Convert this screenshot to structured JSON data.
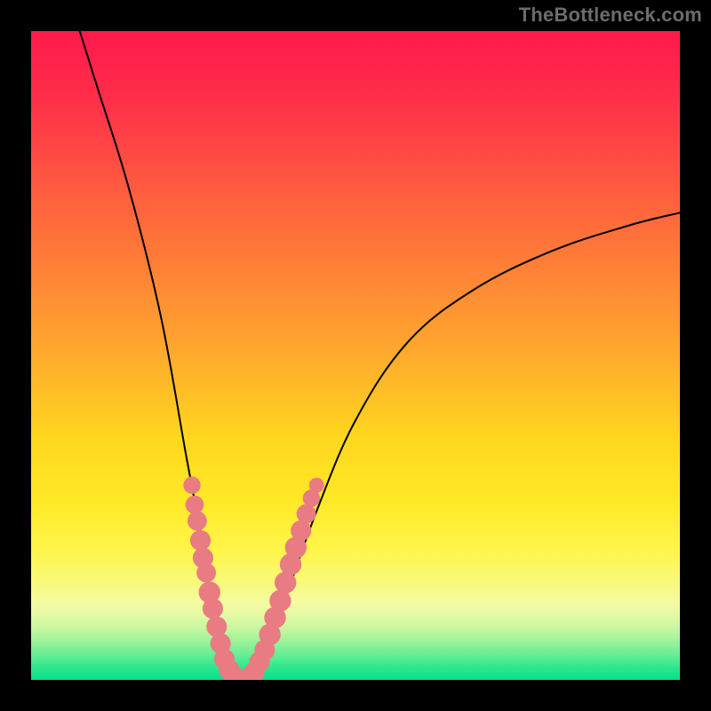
{
  "watermark": "TheBottleneck.com",
  "colors": {
    "bg": "#000000",
    "gradient_top": "#ff1a4b",
    "gradient_bottom": "#00e28b",
    "curve": "#000000",
    "marker": "#e97b82"
  },
  "chart_data": {
    "type": "line",
    "title": "",
    "xlabel": "",
    "ylabel": "",
    "xlim": [
      0,
      100
    ],
    "ylim": [
      0,
      100
    ],
    "grid": false,
    "legend": false,
    "curve_min_x": 32.5,
    "left_start_y": 108,
    "right_end_y": 72,
    "series": [
      {
        "name": "curve",
        "x": [
          5,
          10,
          15,
          20,
          24,
          27,
          29,
          31,
          32.5,
          34,
          36,
          39,
          44,
          50,
          58,
          68,
          80,
          92,
          100
        ],
        "values": [
          108,
          92,
          76,
          56,
          34,
          18,
          6,
          0.5,
          0,
          0.5,
          4,
          12,
          26,
          40,
          52,
          60,
          66,
          70,
          72
        ]
      }
    ],
    "markers": {
      "name": "highlighted-points",
      "points": [
        {
          "x": 24.8,
          "y": 30.0,
          "r": 1.0
        },
        {
          "x": 25.2,
          "y": 27.0,
          "r": 1.1
        },
        {
          "x": 25.6,
          "y": 24.5,
          "r": 1.2
        },
        {
          "x": 26.1,
          "y": 21.5,
          "r": 1.3
        },
        {
          "x": 26.5,
          "y": 18.8,
          "r": 1.3
        },
        {
          "x": 27.0,
          "y": 16.5,
          "r": 1.2
        },
        {
          "x": 27.5,
          "y": 13.5,
          "r": 1.4
        },
        {
          "x": 28.0,
          "y": 11.0,
          "r": 1.3
        },
        {
          "x": 28.6,
          "y": 8.2,
          "r": 1.3
        },
        {
          "x": 29.2,
          "y": 5.6,
          "r": 1.3
        },
        {
          "x": 29.8,
          "y": 3.2,
          "r": 1.3
        },
        {
          "x": 30.5,
          "y": 1.6,
          "r": 1.3
        },
        {
          "x": 31.2,
          "y": 0.6,
          "r": 1.3
        },
        {
          "x": 32.0,
          "y": 0.1,
          "r": 1.3
        },
        {
          "x": 32.8,
          "y": 0.0,
          "r": 1.3
        },
        {
          "x": 33.6,
          "y": 0.3,
          "r": 1.3
        },
        {
          "x": 34.4,
          "y": 1.2,
          "r": 1.3
        },
        {
          "x": 35.2,
          "y": 2.8,
          "r": 1.3
        },
        {
          "x": 36.0,
          "y": 4.6,
          "r": 1.3
        },
        {
          "x": 36.8,
          "y": 7.0,
          "r": 1.4
        },
        {
          "x": 37.6,
          "y": 9.6,
          "r": 1.4
        },
        {
          "x": 38.4,
          "y": 12.2,
          "r": 1.4
        },
        {
          "x": 39.2,
          "y": 15.0,
          "r": 1.4
        },
        {
          "x": 40.0,
          "y": 17.8,
          "r": 1.4
        },
        {
          "x": 40.8,
          "y": 20.4,
          "r": 1.4
        },
        {
          "x": 41.6,
          "y": 23.0,
          "r": 1.3
        },
        {
          "x": 42.4,
          "y": 25.6,
          "r": 1.2
        },
        {
          "x": 43.2,
          "y": 28.0,
          "r": 1.0
        },
        {
          "x": 44.0,
          "y": 30.0,
          "r": 0.8
        }
      ]
    }
  }
}
